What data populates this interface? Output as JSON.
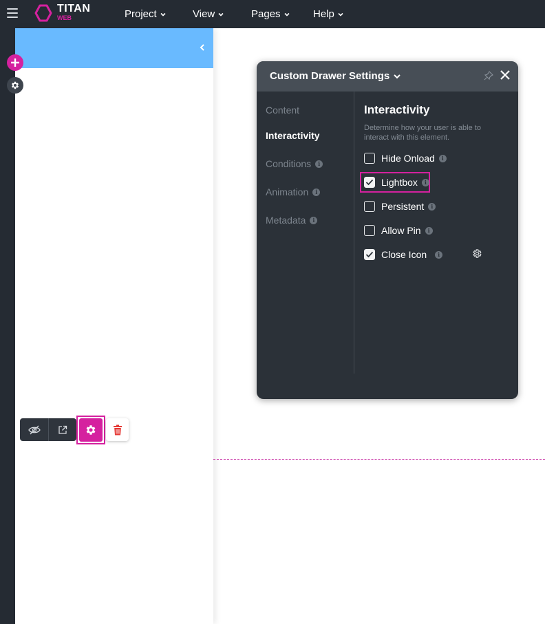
{
  "topbar": {
    "brand_name": "TITAN",
    "brand_sub": "WEB",
    "menus": [
      "Project",
      "View",
      "Pages",
      "Help"
    ]
  },
  "panel": {
    "title": "Custom Drawer Settings",
    "nav": [
      {
        "label": "Content",
        "active": false,
        "info": false
      },
      {
        "label": "Interactivity",
        "active": true,
        "info": false
      },
      {
        "label": "Conditions",
        "active": false,
        "info": true
      },
      {
        "label": "Animation",
        "active": false,
        "info": true
      },
      {
        "label": "Metadata",
        "active": false,
        "info": true
      }
    ],
    "section_title": "Interactivity",
    "section_desc": "Determine how your user is able to interact with this element.",
    "options": [
      {
        "label": "Hide Onload",
        "checked": false
      },
      {
        "label": "Lightbox",
        "checked": true
      },
      {
        "label": "Persistent",
        "checked": false
      },
      {
        "label": "Allow Pin",
        "checked": false
      },
      {
        "label": "Close Icon",
        "checked": true
      }
    ],
    "info_glyph": "i"
  },
  "icons": {
    "menu": "hamburger-icon",
    "add": "plus-icon",
    "settings": "gear-icon",
    "collapse": "chevron-left-icon",
    "visibility": "eye-off-icon",
    "open": "external-link-icon",
    "delete": "trash-icon",
    "pin": "pin-icon",
    "close": "close-icon"
  },
  "colors": {
    "accent": "#d5219f",
    "topbar": "#252b33",
    "panel_bg": "#2b3138",
    "panel_header": "#474e56",
    "drawer_header": "#69baff",
    "delete": "#e53935"
  }
}
